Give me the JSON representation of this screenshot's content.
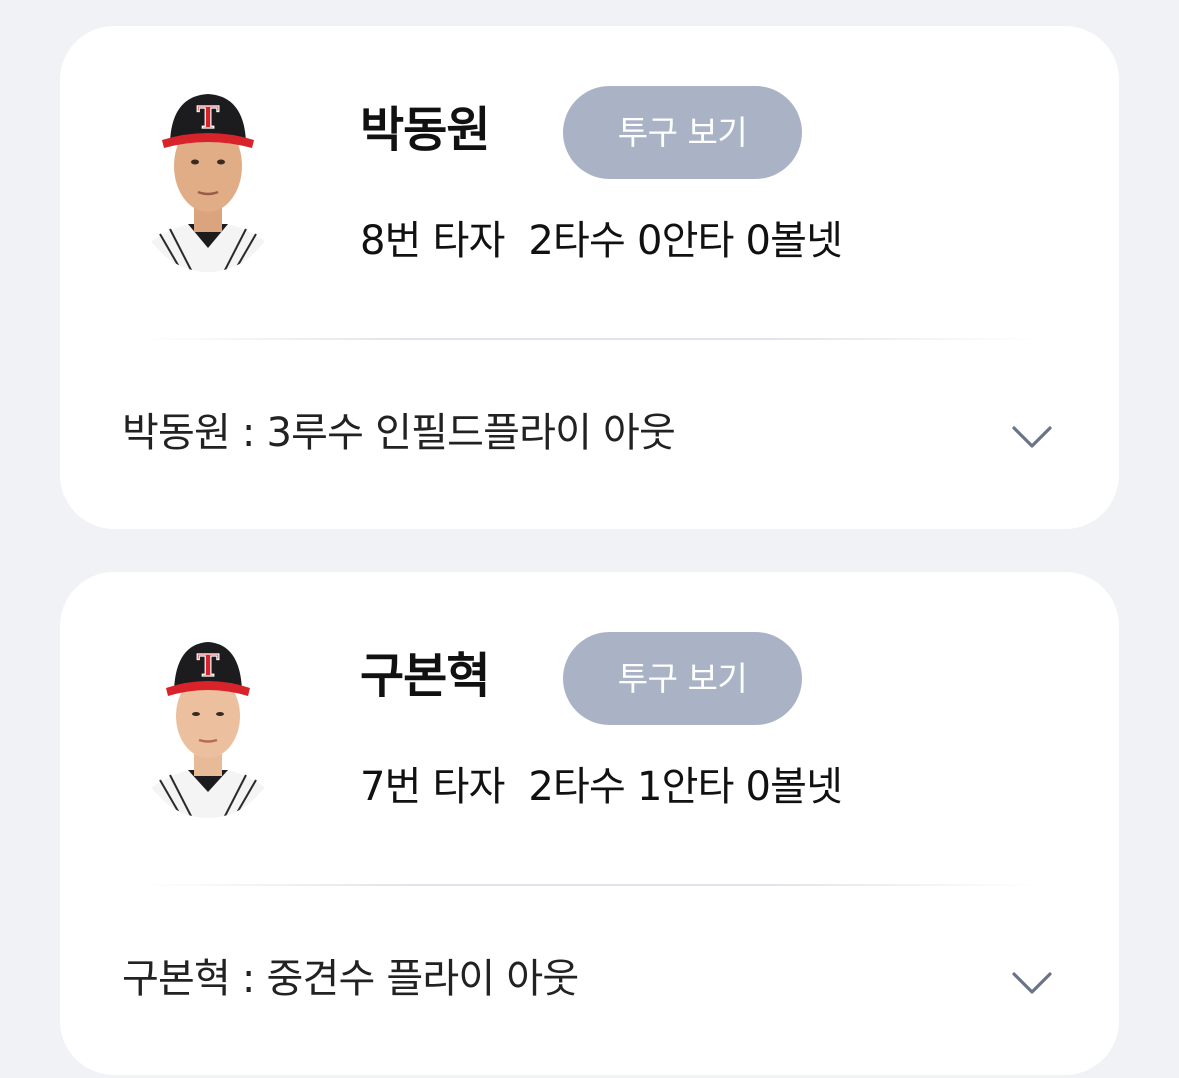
{
  "players": [
    {
      "name": "박동원",
      "pitch_button_label": "투구 보기",
      "stats": "8번 타자  2타수 0안타 0볼넷",
      "result": "박동원 : 3루수 인필드플라이 아웃",
      "cap_logo": "T"
    },
    {
      "name": "구본혁",
      "pitch_button_label": "투구 보기",
      "stats": "7번 타자  2타수 1안타 0볼넷",
      "result": "구본혁 : 중견수 플라이 아웃",
      "cap_logo": "T"
    }
  ],
  "colors": {
    "background": "#f1f2f5",
    "card": "#ffffff",
    "button": "#aab3c6",
    "cap": "#1c1c1e",
    "cap_accent": "#d8232a"
  },
  "icons": {
    "expand": "chevron-down-icon",
    "avatar": "player-photo"
  }
}
